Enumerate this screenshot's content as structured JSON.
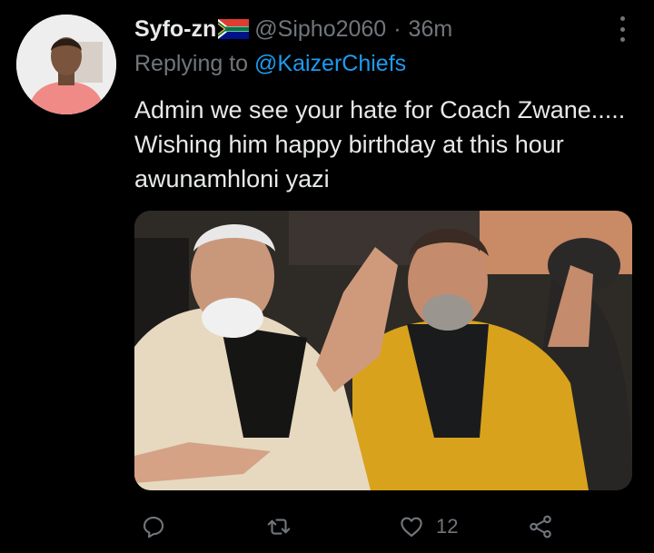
{
  "tweet": {
    "display_name": "Syfo-zn",
    "flag_icon": "south-africa-flag-icon",
    "handle": "@Sipho2060",
    "separator": "·",
    "time": "36m",
    "replying_prefix": "Replying to",
    "replying_to": "@KaizerChiefs",
    "text": "Admin we see your hate for Coach Zwane..... Wishing him happy birthday at this hour awunamhloni yazi"
  },
  "actions": {
    "reply_icon": "reply-icon",
    "retweet_icon": "retweet-icon",
    "like_icon": "heart-icon",
    "like_count": "12",
    "share_icon": "share-icon"
  },
  "colors": {
    "background": "#000000",
    "primary_text": "#e7e9ea",
    "secondary_text": "#71767b",
    "link": "#1d9bf0"
  }
}
